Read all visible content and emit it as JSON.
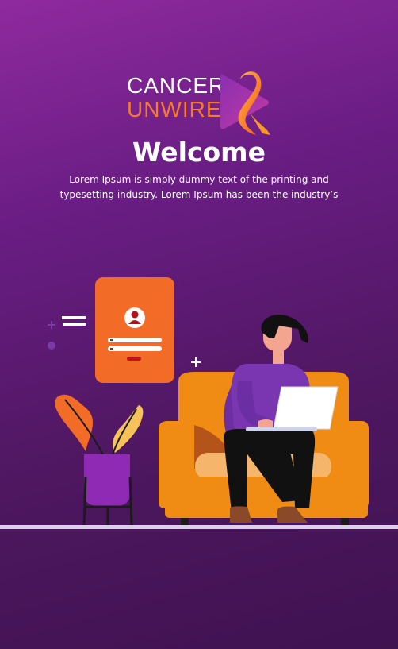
{
  "brand": {
    "line1": "CANCER",
    "line2": "UNWIRED"
  },
  "welcome": {
    "title": "Welcome",
    "description": "Lorem Ipsum is simply dummy text of the printing and typesetting industry. Lorem Ipsum has been the industry’s"
  },
  "colors": {
    "background_top": "#8f2a9e",
    "background_bottom": "#3f1250",
    "accent_orange": "#f57b2a",
    "sofa": "#f08c14",
    "phone_card": "#f26b27"
  }
}
